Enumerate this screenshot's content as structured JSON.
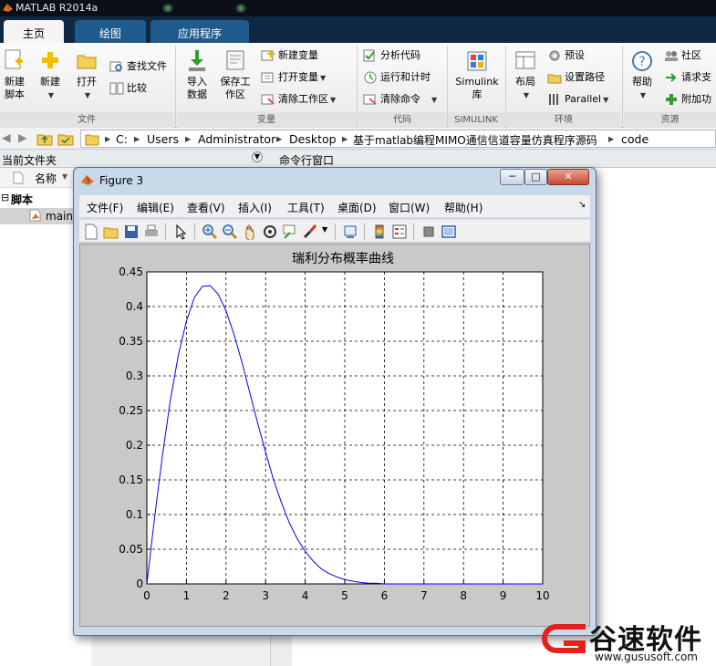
{
  "app": {
    "title": "MATLAB R2014a"
  },
  "tabs": [
    {
      "label": "主页",
      "active": true
    },
    {
      "label": "绘图",
      "active": false
    },
    {
      "label": "应用程序",
      "active": false
    }
  ],
  "ribbon": {
    "file": {
      "new_script": "新建脚本",
      "new": "新建",
      "open": "打开",
      "find_files": "查找文件",
      "compare": "比较",
      "section": "文件"
    },
    "variable": {
      "import_data": "导入数据",
      "save_workspace": "保存工作区",
      "new_variable": "新建变量",
      "open_variable": "打开变量",
      "clear_workspace": "清除工作区",
      "section": "变量"
    },
    "code": {
      "analyze": "分析代码",
      "run_time": "运行和计时",
      "clear_commands": "清除命令",
      "section": "代码"
    },
    "simulink": {
      "label": "Simulink 库",
      "section": "SIMULINK"
    },
    "env": {
      "layout": "布局",
      "preferences": "预设",
      "set_path": "设置路径",
      "parallel": "Parallel",
      "section": "环境"
    },
    "resources": {
      "help": "帮助",
      "community": "社区",
      "request_support": "请求支",
      "addons": "附加功",
      "section": "资源"
    }
  },
  "path": {
    "segments": [
      "C:",
      "Users",
      "Administrator",
      "Desktop",
      "基于matlab编程MIMO通信信道容量仿真程序源码",
      "code"
    ],
    "separator": "▸"
  },
  "panes": {
    "current_folder": "当前文件夹",
    "command_window": "命令行窗口",
    "name_col": "名称",
    "group": "脚本",
    "file": "main"
  },
  "figure": {
    "window_title": "Figure 3",
    "menu": [
      "文件(F)",
      "编辑(E)",
      "查看(V)",
      "插入(I)",
      "工具(T)",
      "桌面(D)",
      "窗口(W)",
      "帮助(H)"
    ],
    "minimize": "─",
    "maximize": "□",
    "close": "✕",
    "toolbar_icons": [
      "new-figure-icon",
      "open-file-icon",
      "save-icon",
      "print-icon",
      "pointer-icon",
      "zoom-in-icon",
      "zoom-out-icon",
      "pan-icon",
      "rotate-icon",
      "data-cursor-icon",
      "brush-icon",
      "link-plot-icon",
      "colorbar-icon",
      "legend-icon",
      "hide-plot-tools-icon",
      "show-plot-tools-icon"
    ]
  },
  "chart_data": {
    "type": "line",
    "title": "瑞利分布概率曲线",
    "xlabel": "",
    "ylabel": "",
    "xlim": [
      0,
      10
    ],
    "ylim": [
      0,
      0.45
    ],
    "xticks": [
      0,
      1,
      2,
      3,
      4,
      5,
      6,
      7,
      8,
      9,
      10
    ],
    "yticks": [
      0,
      0.05,
      0.1,
      0.15,
      0.2,
      0.25,
      0.3,
      0.35,
      0.4,
      0.45
    ],
    "grid": true,
    "line_color": "#0000ff",
    "series": [
      {
        "x": [
          0,
          0.2,
          0.4,
          0.6,
          0.8,
          1.0,
          1.2,
          1.4,
          1.6,
          1.8,
          2.0,
          2.2,
          2.4,
          2.6,
          2.8,
          3.0,
          3.2,
          3.4,
          3.6,
          3.8,
          4.0,
          4.2,
          4.4,
          4.6,
          4.8,
          5.0,
          5.2,
          5.4,
          5.6,
          5.8,
          6.0,
          7.0,
          8.0,
          9.0,
          10.0
        ],
        "y": [
          0,
          0.098,
          0.188,
          0.267,
          0.331,
          0.379,
          0.413,
          0.429,
          0.43,
          0.418,
          0.394,
          0.36,
          0.32,
          0.276,
          0.232,
          0.19,
          0.15,
          0.117,
          0.088,
          0.065,
          0.047,
          0.033,
          0.022,
          0.015,
          0.01,
          0.006,
          0.004,
          0.002,
          0.001,
          0.001,
          0.0,
          0.0,
          0.0,
          0.0,
          0.0
        ]
      }
    ]
  },
  "watermark": {
    "brand": "谷速软件",
    "url": "www.gususoft.com"
  },
  "colors": {
    "tab_bar": "#0f2942",
    "titlebar": "#0b0f18",
    "accent": "#1f5a8c",
    "watermark_red": "#e5211d"
  }
}
